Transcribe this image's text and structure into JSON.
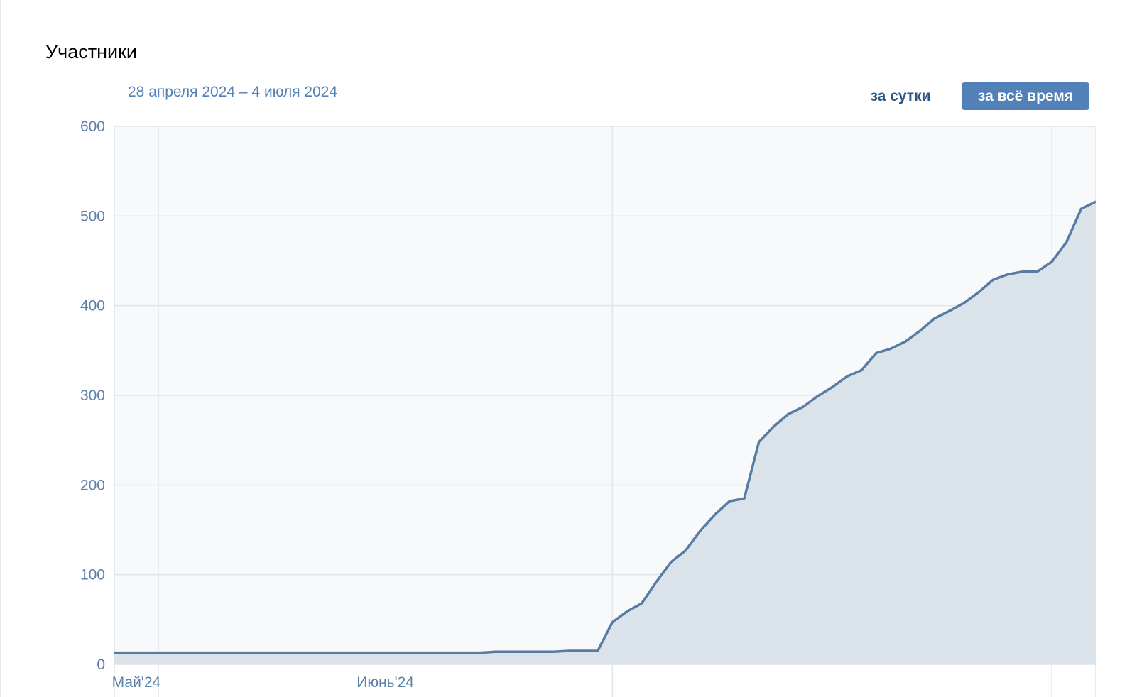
{
  "title": "Участники",
  "date_range": "28 апреля 2024 – 4 июля 2024",
  "buttons": {
    "per_day": "за сутки",
    "all_time": "за всё время"
  },
  "colors": {
    "line": "#587ba3",
    "area": "#dae2ea",
    "plot_bg": "#f7f9fb",
    "grid": "#e1e5ea",
    "accent": "#5181b8"
  },
  "chart_data": {
    "type": "area",
    "title": "Участники",
    "xlabel": "",
    "ylabel": "",
    "ylim": [
      0,
      600
    ],
    "yticks": [
      "0",
      "100",
      "200",
      "300",
      "400",
      "500",
      "600"
    ],
    "xtick_labels": [
      "Май'24",
      "Июнь'24"
    ],
    "grid": true,
    "x": [
      "2024-04-28",
      "2024-04-29",
      "2024-04-30",
      "2024-05-01",
      "2024-05-02",
      "2024-05-03",
      "2024-05-04",
      "2024-05-05",
      "2024-05-06",
      "2024-05-07",
      "2024-05-08",
      "2024-05-09",
      "2024-05-10",
      "2024-05-11",
      "2024-05-12",
      "2024-05-13",
      "2024-05-14",
      "2024-05-15",
      "2024-05-16",
      "2024-05-17",
      "2024-05-18",
      "2024-05-19",
      "2024-05-20",
      "2024-05-21",
      "2024-05-22",
      "2024-05-23",
      "2024-05-24",
      "2024-05-25",
      "2024-05-26",
      "2024-05-27",
      "2024-05-28",
      "2024-05-29",
      "2024-05-30",
      "2024-05-31",
      "2024-06-01",
      "2024-06-02",
      "2024-06-03",
      "2024-06-04",
      "2024-06-05",
      "2024-06-06",
      "2024-06-07",
      "2024-06-08",
      "2024-06-09",
      "2024-06-10",
      "2024-06-11",
      "2024-06-12",
      "2024-06-13",
      "2024-06-14",
      "2024-06-15",
      "2024-06-16",
      "2024-06-17",
      "2024-06-18",
      "2024-06-19",
      "2024-06-20",
      "2024-06-21",
      "2024-06-22",
      "2024-06-23",
      "2024-06-24",
      "2024-06-25",
      "2024-06-26",
      "2024-06-27",
      "2024-06-28",
      "2024-06-29",
      "2024-06-30",
      "2024-07-01",
      "2024-07-02",
      "2024-07-03",
      "2024-07-04"
    ],
    "series": [
      {
        "values": [
          13,
          13,
          13,
          13,
          13,
          13,
          13,
          13,
          13,
          13,
          13,
          13,
          13,
          13,
          13,
          13,
          13,
          13,
          13,
          13,
          13,
          13,
          13,
          13,
          13,
          13,
          14,
          14,
          14,
          14,
          14,
          15,
          15,
          15,
          47,
          59,
          68,
          92,
          114,
          127,
          149,
          167,
          182,
          185,
          248,
          265,
          279,
          287,
          299,
          309,
          321,
          328,
          347,
          352,
          360,
          372,
          386,
          394,
          403,
          415,
          429,
          435,
          438,
          438,
          449,
          471,
          508,
          516
        ]
      }
    ]
  }
}
